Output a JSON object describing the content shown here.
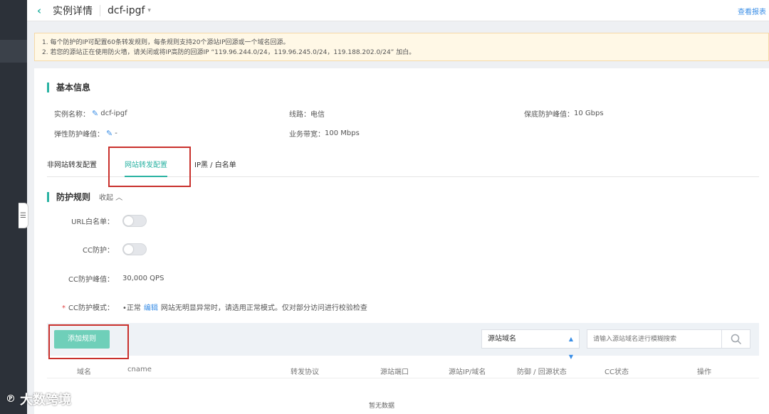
{
  "header": {
    "title": "实例详情",
    "instance": "dcf-ipgf",
    "report_link": "查看报表"
  },
  "notice": {
    "line1": "1. 每个防护的IP可配置60条转发规则，每条规则支持20个源站IP回源或一个域名回源。",
    "line2": "2. 若您的源站正在使用防火墙，请关闭或将IP高防的回源IP “119.96.244.0/24，119.96.245.0/24，119.188.202.0/24” 加白。"
  },
  "basic_info": {
    "title": "基本信息",
    "instance_name_label": "实例名称：",
    "instance_name": "dcf-ipgf",
    "line_label": "线路：",
    "line": "电信",
    "base_protect_label": "保底防护峰值：",
    "base_protect": "10 Gbps",
    "elastic_label": "弹性防护峰值：",
    "elastic": "-",
    "bandwidth_label": "业务带宽：",
    "bandwidth": "100 Mbps"
  },
  "tabs": [
    {
      "label": "非网站转发配置"
    },
    {
      "label": "网站转发配置"
    },
    {
      "label": "IP黑 / 白名单"
    }
  ],
  "rules": {
    "title": "防护规则",
    "collapse": "收起",
    "url_whitelist_label": "URL白名单：",
    "cc_label": "CC防护：",
    "cc_peak_label": "CC防护峰值：",
    "cc_peak": "30,000 QPS",
    "cc_mode_label": "CC防护模式：",
    "cc_mode_value": "•正常",
    "cc_mode_edit": "编辑",
    "cc_mode_desc": "网站无明显异常时，请选用正常模式。仅对部分访问进行校验检查"
  },
  "toolbar": {
    "add_rule": "添加规则",
    "select_value": "源站域名",
    "search_placeholder": "请输入源站域名进行模糊搜索"
  },
  "table": {
    "columns": [
      "域名",
      "cname",
      "转发协议",
      "源站端口",
      "源站IP/域名",
      "防御 / 回源状态",
      "CC状态",
      "操作"
    ],
    "empty": "暂无数据"
  },
  "watermark": {
    "brand": "大数跨境"
  },
  "colors": {
    "accent": "#2bb3a3",
    "link": "#3a8ee6",
    "highlight": "#c9302c"
  }
}
